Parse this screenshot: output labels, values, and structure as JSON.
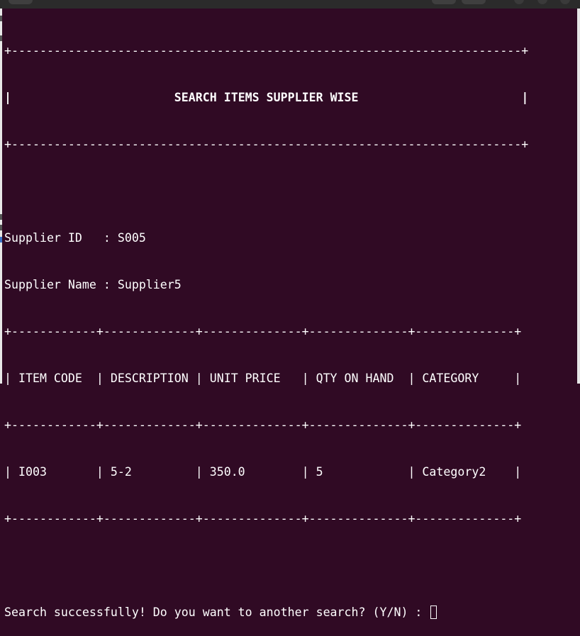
{
  "terminal": {
    "border_line": "+------------------------------------------------------------------------+",
    "title_left": "|",
    "title_pad_left": "                       ",
    "title": "SEARCH ITEMS SUPPLIER WISE",
    "title_pad_right": "                       ",
    "title_right": "|",
    "blank": "",
    "supplier_id_line": "Supplier ID   : S005",
    "supplier_name_line": "Supplier Name : Supplier5",
    "table_border": "+------------+-------------+--------------+--------------+--------------+",
    "table_header": "| ITEM CODE  | DESCRIPTION | UNIT PRICE   | QTY ON HAND  | CATEGORY     |",
    "table_rows": [
      "| I003       | 5-2         | 350.0        | 5            | Category2    |"
    ],
    "prompt": "Search successfully! Do you want to another search? (Y/N) : ",
    "input_value": ""
  },
  "colors": {
    "background": "#300a24",
    "foreground": "#ffffff"
  }
}
